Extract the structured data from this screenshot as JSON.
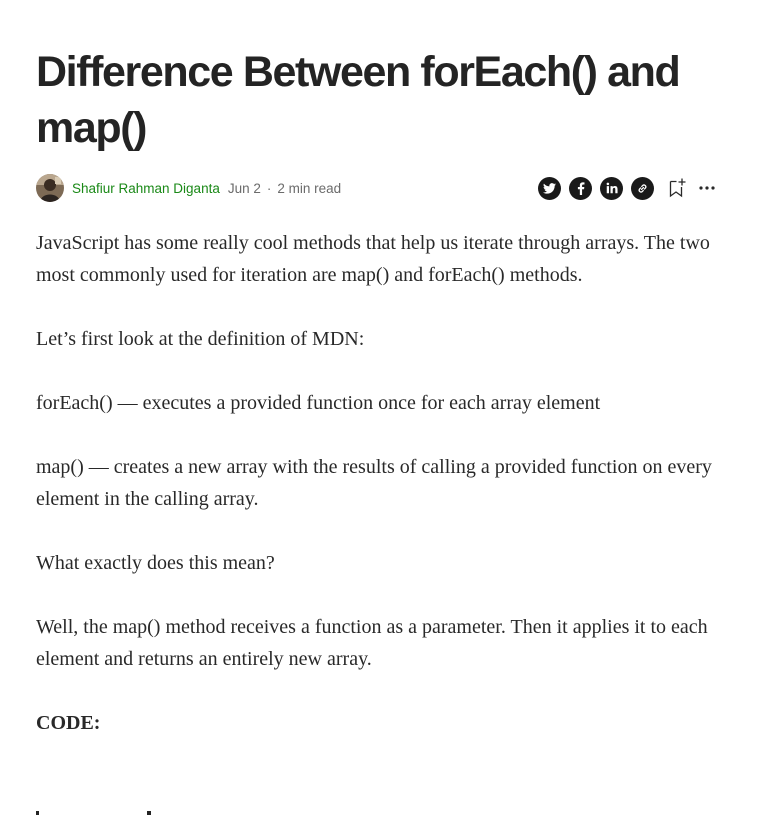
{
  "article": {
    "title": "Difference Between forEach() and map()",
    "author": "Shafiur Rahman Diganta",
    "date": "Jun 2",
    "separator": "·",
    "read_time": "2 min read",
    "paragraphs": [
      "JavaScript has some really cool methods that help us iterate through arrays. The two most commonly used for iteration are map() and forEach() methods.",
      "Let’s first look at the definition of MDN:",
      "forEach() — executes a provided function once for each array element",
      "map() — creates a new array with the results of calling a provided function on every element in the calling array.",
      "What exactly does this mean?",
      "Well, the map() method receives a function as a parameter. Then it applies it to each element and returns an entirely new array."
    ],
    "code_heading": "CODE:"
  },
  "share": {
    "icons": [
      "twitter-icon",
      "facebook-icon",
      "linkedin-icon",
      "link-icon",
      "bookmark-add-icon",
      "more-icon"
    ]
  },
  "colors": {
    "author": "#1a8917",
    "text": "#292929",
    "muted": "#6b6b6b",
    "icon_bg": "#1a1a1a"
  }
}
